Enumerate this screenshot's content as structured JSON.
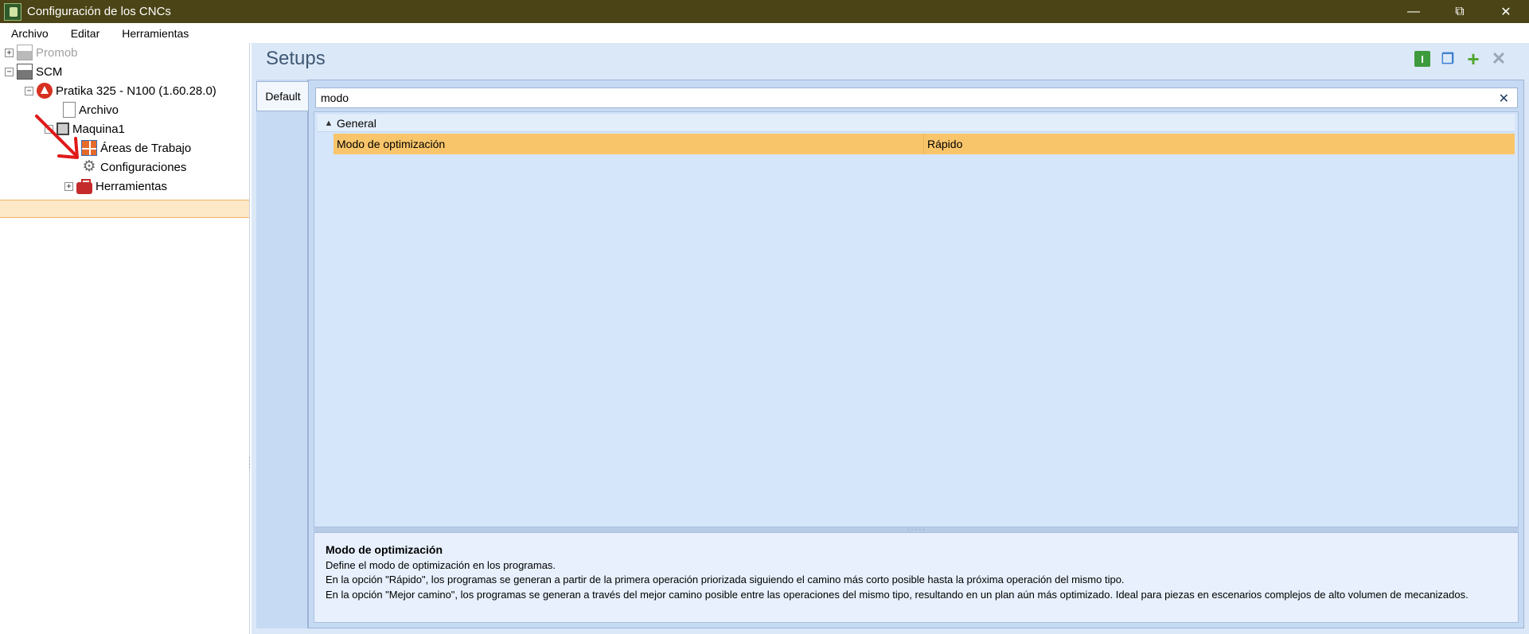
{
  "window": {
    "title": "Configuración de los CNCs"
  },
  "menu": [
    "Archivo",
    "Editar",
    "Herramientas"
  ],
  "tree": [
    {
      "label": "Promob",
      "icon": "factory-icon",
      "disabled": true
    },
    {
      "label": "SCM",
      "icon": "factory-icon"
    },
    {
      "label": "Pratika 325 - N100 (1.60.28.0)",
      "icon": "brand-logo-icon"
    },
    {
      "label": "Archivo",
      "icon": "document-icon"
    },
    {
      "label": "Maquina1",
      "icon": "machine-icon"
    },
    {
      "label": "Áreas de Trabajo",
      "icon": "grid-icon"
    },
    {
      "label": "Configuraciones",
      "icon": "gear-icon",
      "selected": true
    },
    {
      "label": "Herramientas",
      "icon": "toolbox-icon"
    }
  ],
  "main": {
    "title": "Setups",
    "tab": "Default",
    "search_value": "modo",
    "group": "General",
    "property": {
      "name": "Modo de optimización",
      "value": "Rápido"
    },
    "description": {
      "title": "Modo de optimización",
      "lines": [
        "Define el modo de optimización en los programas.",
        "En la opción \"Rápido\", los programas se generan a partir de la primera operación priorizada siguiendo el camino más corto posible hasta la próxima operación del mismo tipo.",
        "En la opción \"Mejor camino\", los programas se generan a través del mejor camino posible entre las operaciones del mismo tipo, resultando en un plan aún más optimizado. Ideal para piezas en escenarios complejos de alto volumen de mecanizados."
      ]
    }
  },
  "colors": {
    "titlebar": "#4b4416",
    "selected_property": "#f8c56a",
    "panel": "#dbe8f8"
  }
}
